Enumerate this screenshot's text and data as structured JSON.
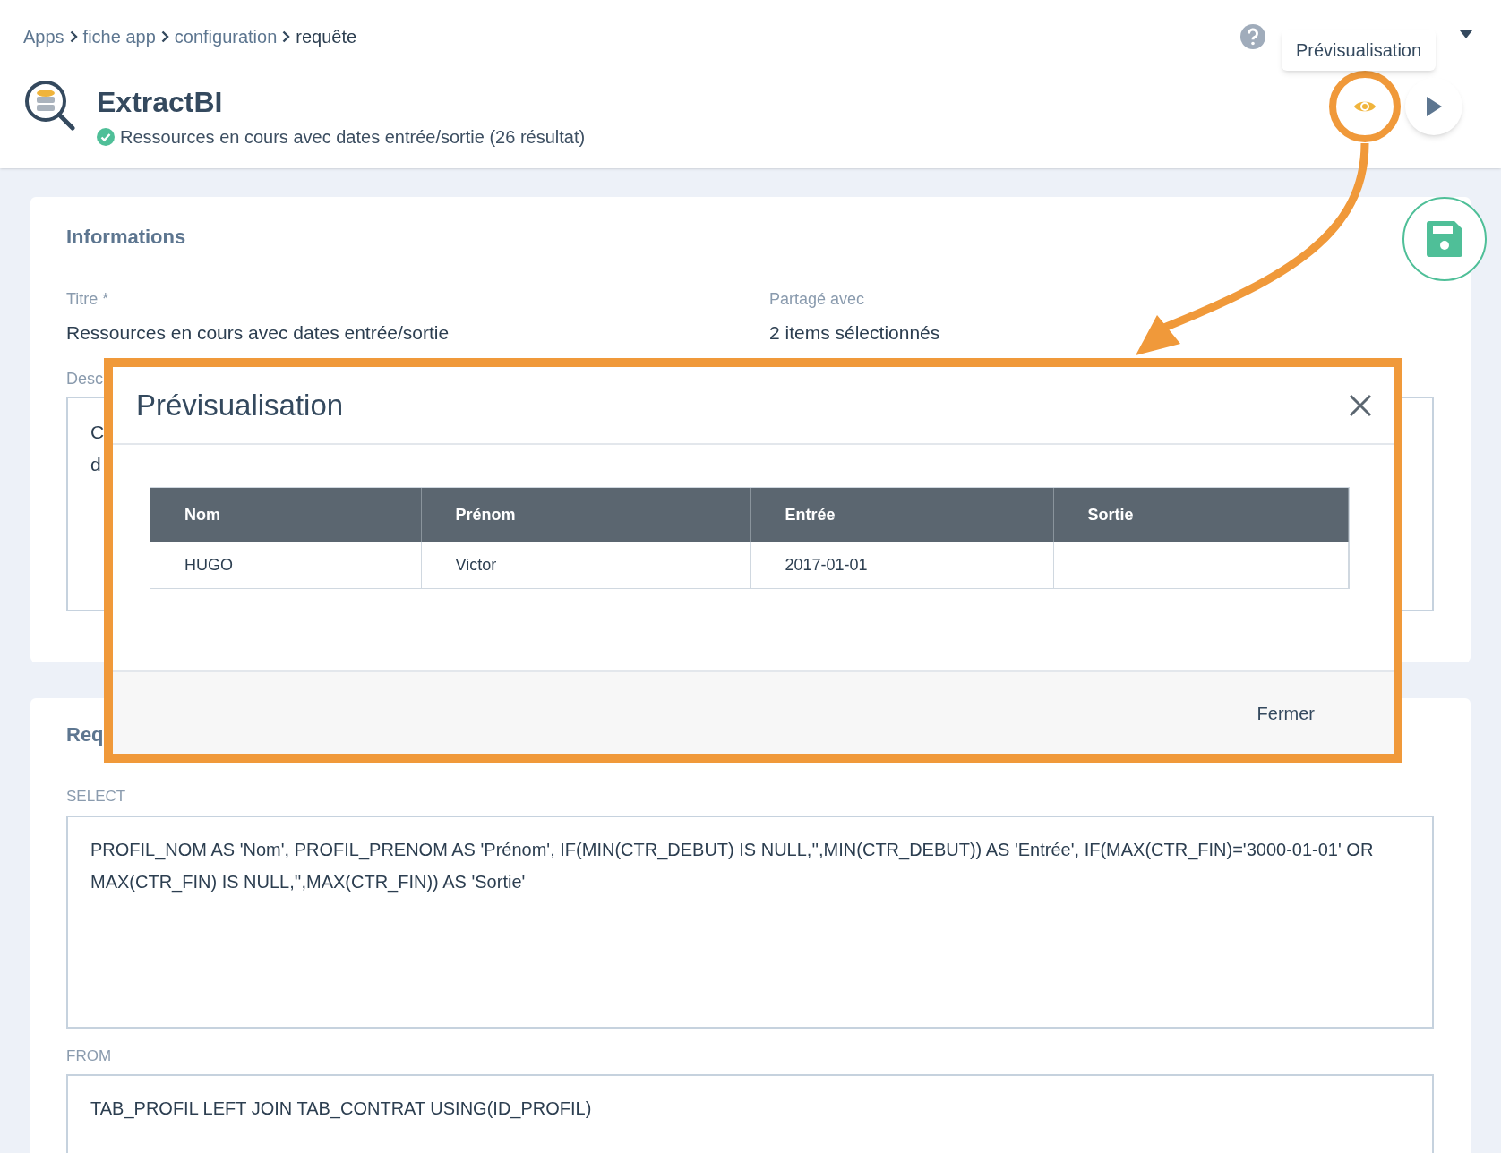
{
  "breadcrumb": [
    {
      "label": "Apps",
      "current": false
    },
    {
      "label": "fiche app",
      "current": false
    },
    {
      "label": "configuration",
      "current": false
    },
    {
      "label": "requête",
      "current": true
    }
  ],
  "header": {
    "title": "ExtractBI",
    "status": "Ressources en cours avec dates entrée/sortie (26 résultat)"
  },
  "tooltip": "Prévisualisation",
  "informations": {
    "heading": "Informations",
    "fields": [
      {
        "label": "Titre *",
        "value": "Ressources en cours avec dates entrée/sortie"
      },
      {
        "label": "Partagé avec",
        "value": "2 items sélectionnés"
      }
    ],
    "description": {
      "label": "Desc",
      "lines": [
        "C",
        "d"
      ]
    }
  },
  "requete": {
    "heading": "Req",
    "fields": [
      {
        "label": "SELECT",
        "value": "PROFIL_NOM AS 'Nom', PROFIL_PRENOM AS 'Prénom', IF(MIN(CTR_DEBUT) IS NULL,'',MIN(CTR_DEBUT)) AS 'Entrée', IF(MAX(CTR_FIN)='3000-01-01' OR MAX(CTR_FIN) IS NULL,'',MAX(CTR_FIN)) AS 'Sortie'"
      },
      {
        "label": "FROM",
        "value": "TAB_PROFIL LEFT JOIN TAB_CONTRAT USING(ID_PROFIL)"
      }
    ]
  },
  "dialog": {
    "title": "Prévisualisation",
    "columns": [
      "Nom",
      "Prénom",
      "Entrée",
      "Sortie"
    ],
    "rows": [
      [
        "HUGO",
        "Victor",
        "2017-01-01"
      ]
    ],
    "close_button": "Fermer"
  }
}
